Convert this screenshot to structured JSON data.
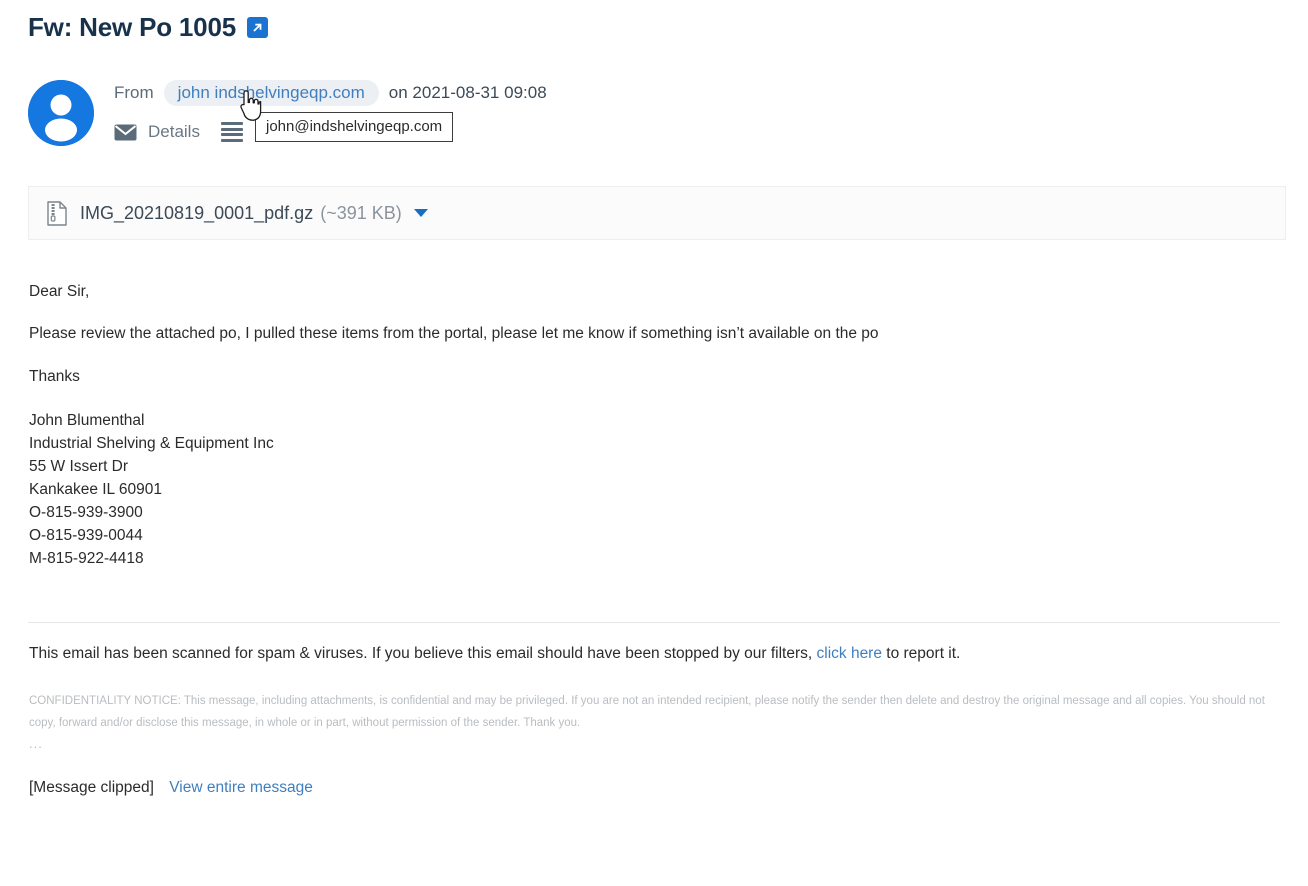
{
  "header": {
    "subject": "Fw: New Po 1005",
    "open_icon": "external-link-icon"
  },
  "sender": {
    "avatar_icon": "user-avatar-icon",
    "from_label": "From",
    "display_address": "john indshelvingeqp.com",
    "date_text": "on 2021-08-31 09:08",
    "details_label": "Details",
    "details_icon": "envelope-icon",
    "menu_icon": "hamburger-icon",
    "tooltip_text": "john@indshelvingeqp.com",
    "cursor_icon": "pointer-hand-cursor"
  },
  "attachment": {
    "icon": "archive-file-icon",
    "filename": "IMG_20210819_0001_pdf.gz",
    "size": "(~391 KB)",
    "menu_icon": "caret-down-icon"
  },
  "body": {
    "greeting": "Dear Sir,",
    "paragraph": "Please review the attached po, I pulled these items from the portal, please let me know if something isn’t available on the po",
    "closing": "Thanks",
    "signature": [
      "John Blumenthal",
      "Industrial Shelving & Equipment Inc",
      "55 W Issert Dr",
      "Kankakee IL 60901",
      "O-815-939-3900",
      "O-815-939-0044",
      "M-815-922-4418"
    ]
  },
  "footer": {
    "spam_prefix": "This email has been scanned for spam & viruses. If you believe this email should have been stopped by our filters,",
    "spam_link": "click here",
    "spam_suffix": "to report it.",
    "confidentiality": "CONFIDENTIALITY NOTICE: This message, including attachments, is confidential and may be privileged. If you are not an intended recipient, please notify the sender then delete and destroy the original message and all copies. You should not copy, forward and/or disclose this message, in whole or in part, without permission of the sender. Thank you.",
    "ellipsis": "...",
    "clipped_label": "[Message clipped]",
    "view_entire_link": "View entire message"
  },
  "colors": {
    "accent_blue": "#1a73d1",
    "link_blue": "#3f7fbf",
    "avatar_blue": "#1577e0",
    "title_navy": "#17324a"
  }
}
